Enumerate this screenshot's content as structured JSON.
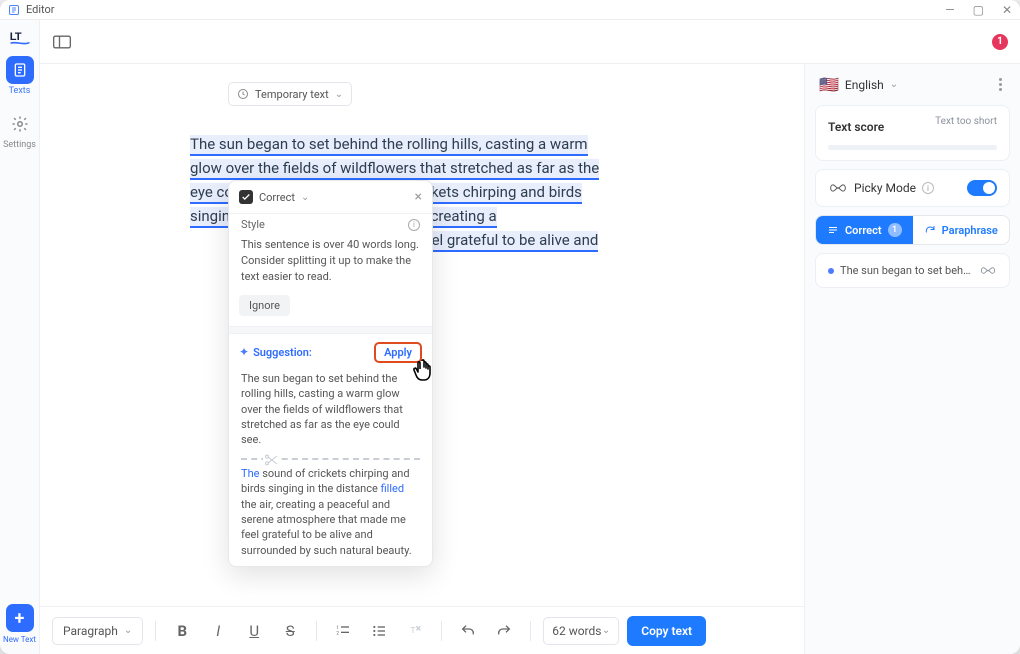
{
  "window": {
    "title": "Editor",
    "controls": {
      "min": "—",
      "max": "▢",
      "close": "✕"
    }
  },
  "leftnav": {
    "texts_label": "Texts",
    "settings_label": "Settings",
    "newtext_label": "New Text",
    "plus": "+"
  },
  "topbar": {
    "notifications_count": "1",
    "language": "English",
    "flag": "🇺🇸"
  },
  "editor": {
    "temp_chip": "Temporary text",
    "paragraph_highlighted": "The sun began to set behind the rolling hills, casting a warm glow over the fields of wildflowers that stretched as far as the eye could see, with the sound of crickets chirping and birds singing in the distance filling the air, creating a",
    "paragraph_tail": "made me feel grateful to be alive and"
  },
  "popup": {
    "type_label": "Correct",
    "close": "×",
    "style_label": "Style",
    "description": "This sentence is over 40 words long. Consider splitting it up to make the text easier to read.",
    "ignore": "Ignore",
    "suggestion_label": "Suggestion:",
    "apply": "Apply",
    "sugg_p1": "The sun began to set behind the rolling hills, casting a warm glow over the fields of wildflowers that stretched as far as the eye could see.",
    "sugg_p2_a": "The",
    "sugg_p2_b": " sound of crickets chirping and birds singing in the distance ",
    "sugg_p2_c": "filled",
    "sugg_p2_d": " the air, creating a peaceful and serene atmosphere that made me feel grateful to be alive and surrounded by such natural beauty."
  },
  "bottombar": {
    "format": "Paragraph",
    "wordcount": "62 words",
    "copy": "Copy text"
  },
  "rightpanel": {
    "score_title": "Text score",
    "score_hint": "Text too short",
    "picky_label": "Picky Mode",
    "tabs": {
      "correct": "Correct",
      "correct_count": "1",
      "paraphrase": "Paraphrase"
    },
    "issue_preview": "The sun began to set behind the roll…"
  }
}
